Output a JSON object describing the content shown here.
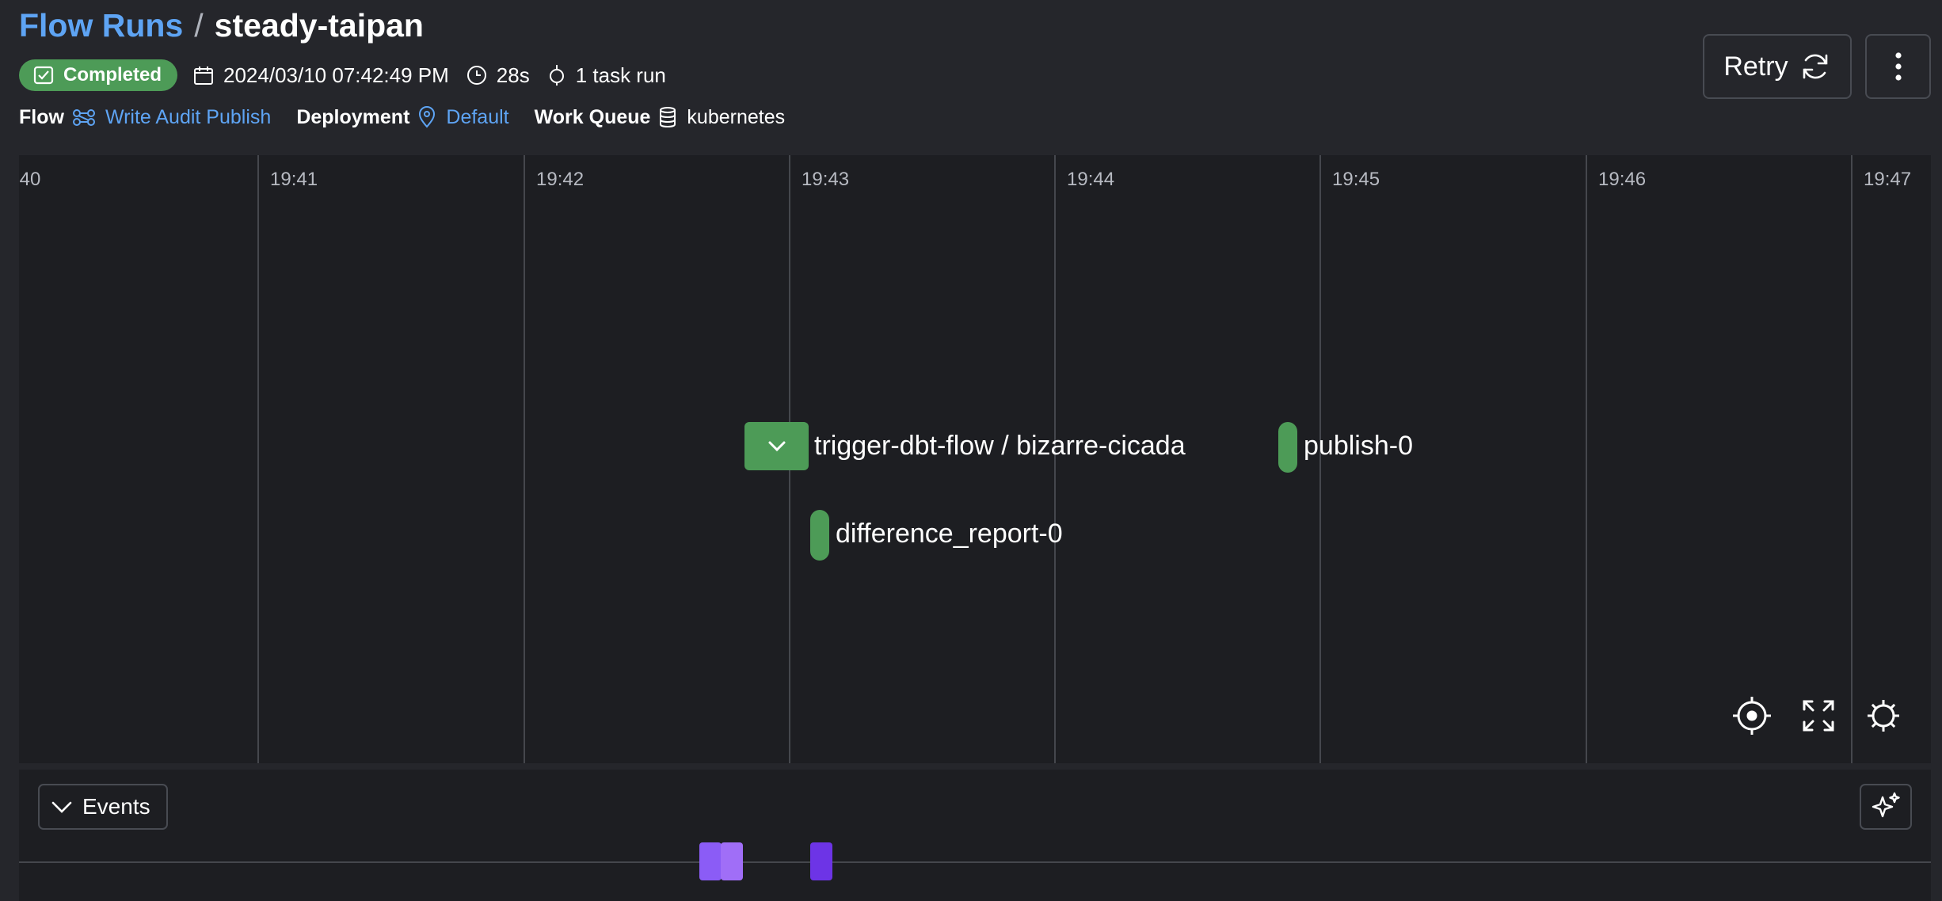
{
  "breadcrumb": {
    "parent": "Flow Runs",
    "separator": "/",
    "current": "steady-taipan"
  },
  "status": {
    "label": "Completed",
    "color": "#4d9b57"
  },
  "meta": {
    "start_time": "2024/03/10 07:42:49 PM",
    "duration": "28s",
    "task_runs": "1 task run"
  },
  "info": {
    "flow_label": "Flow",
    "flow_value": "Write Audit Publish",
    "deployment_label": "Deployment",
    "deployment_value": "Default",
    "work_queue_label": "Work Queue",
    "work_queue_value": "kubernetes"
  },
  "actions": {
    "retry_label": "Retry"
  },
  "timeline": {
    "ticks": [
      ":40",
      "19:41",
      "19:42",
      "19:43",
      "19:44",
      "19:45",
      "19:46",
      "19:47"
    ],
    "nodes": {
      "subflow": "trigger-dbt-flow / bizarre-cicada",
      "task_a": "difference_report-0",
      "task_b": "publish-0"
    },
    "node_color": "#4d9b57"
  },
  "events": {
    "toggle_label": "Events",
    "marker_colors": [
      "#8b5cf6",
      "#a06ef7",
      "#6d34e6"
    ]
  },
  "icons": {
    "status": "check-square-icon",
    "calendar": "calendar-icon",
    "clock": "clock-icon",
    "task": "task-run-icon",
    "flow": "flow-icon",
    "deployment": "location-pin-icon",
    "work_queue": "database-icon",
    "retry": "refresh-icon",
    "more": "kebab-menu-icon",
    "recenter": "crosshair-icon",
    "fullscreen": "expand-icon",
    "settings": "gear-icon",
    "events_chevron": "chevron-down-icon",
    "sparkle": "sparkle-icon"
  }
}
